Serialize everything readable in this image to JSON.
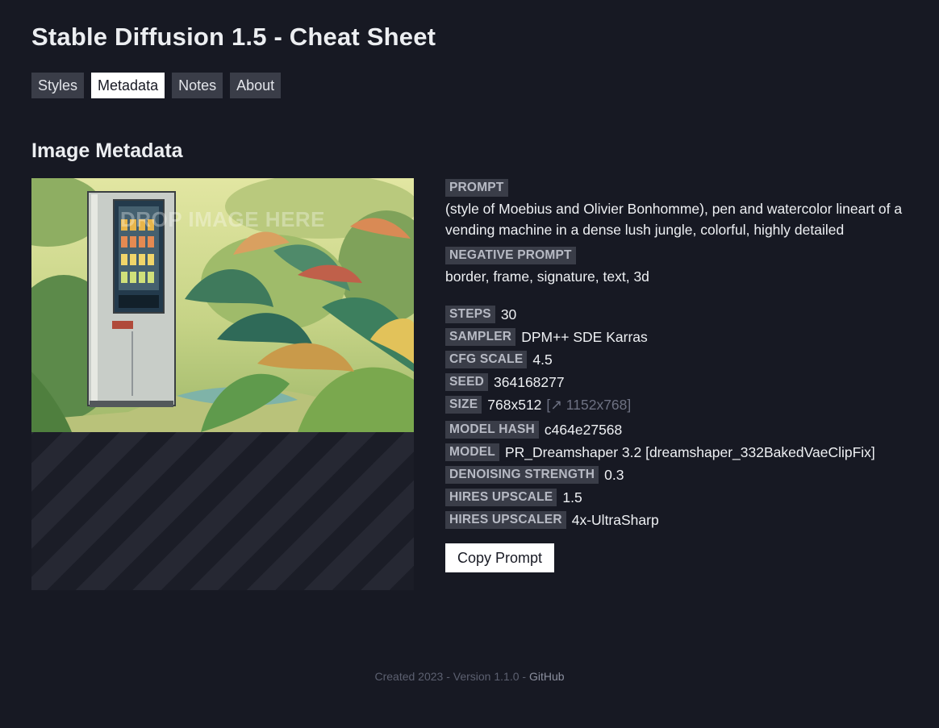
{
  "header": {
    "title": "Stable Diffusion 1.5 - Cheat Sheet"
  },
  "nav": {
    "tabs": [
      {
        "label": "Styles",
        "active": false
      },
      {
        "label": "Metadata",
        "active": true
      },
      {
        "label": "Notes",
        "active": false
      },
      {
        "label": "About",
        "active": false
      }
    ]
  },
  "main": {
    "section_title": "Image Metadata",
    "drop_zone": {
      "hint": "DROP IMAGE HERE",
      "image_subject": "vending machine in lush jungle illustration"
    },
    "metadata": {
      "prompt_label": "PROMPT",
      "prompt": "(style of Moebius and Olivier Bonhomme), pen and watercolor lineart of a vending machine in a dense lush jungle, colorful, highly detailed",
      "negative_label": "NEGATIVE PROMPT",
      "negative": "border, frame, signature, text, 3d",
      "steps_label": "STEPS",
      "steps": "30",
      "sampler_label": "SAMPLER",
      "sampler": "DPM++ SDE Karras",
      "cfg_label": "CFG SCALE",
      "cfg": "4.5",
      "seed_label": "SEED",
      "seed": "364168277",
      "size_label": "SIZE",
      "size": "768x512",
      "size_upscaled": "[↗ 1152x768]",
      "model_hash_label": "MODEL HASH",
      "model_hash": "c464e27568",
      "model_label": "MODEL",
      "model": "PR_Dreamshaper 3.2 [dreamshaper_332BakedVaeClipFix]",
      "denoising_label": "DENOISING STRENGTH",
      "denoising": "0.3",
      "hires_upscale_label": "HIRES UPSCALE",
      "hires_upscale": "1.5",
      "hires_upscaler_label": "HIRES UPSCALER",
      "hires_upscaler": "4x-UltraSharp"
    },
    "copy_button": "Copy Prompt"
  },
  "footer": {
    "text": "Created 2023 - Version 1.1.0 - ",
    "link": "GitHub"
  },
  "colors": {
    "background": "#171923",
    "tag_background": "#3a3d48",
    "active_tab": "#ffffff",
    "muted_text": "#6d7182"
  }
}
